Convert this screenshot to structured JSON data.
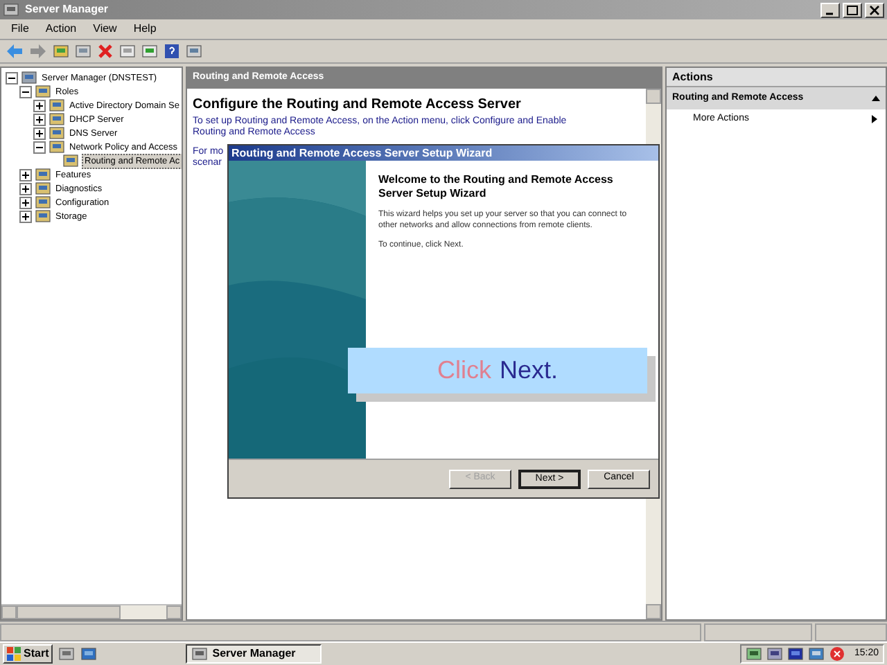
{
  "window": {
    "title": "Server Manager"
  },
  "menu": [
    "File",
    "Action",
    "View",
    "Help"
  ],
  "tree": [
    {
      "label": "Server Manager (DNSTEST)",
      "expanded": true,
      "selected": false,
      "children": [
        {
          "label": "Roles",
          "expanded": true,
          "selected": false,
          "children": [
            {
              "label": "Active Directory Domain Se",
              "expanded": false,
              "selected": false
            },
            {
              "label": "DHCP Server",
              "expanded": false,
              "selected": false
            },
            {
              "label": "DNS Server",
              "expanded": false,
              "selected": false
            },
            {
              "label": "Network Policy and Access",
              "expanded": true,
              "selected": false,
              "children": [
                {
                  "label": "Routing and Remote Ac",
                  "selected": true
                }
              ]
            }
          ]
        },
        {
          "label": "Features",
          "expanded": false,
          "selected": false
        },
        {
          "label": "Diagnostics",
          "expanded": false,
          "selected": false
        },
        {
          "label": "Configuration",
          "expanded": false,
          "selected": false
        },
        {
          "label": "Storage",
          "expanded": false,
          "selected": false
        }
      ]
    }
  ],
  "content": {
    "header": "Routing and Remote Access",
    "heading": "Configure the Routing and Remote Access Server",
    "line_1": "To set up Routing and Remote Access, on the Action menu, click Configure and Enable",
    "line_2": "Routing and Remote Access",
    "line_3": "For mo",
    "line_4": "scenar"
  },
  "actions": {
    "header": "Actions",
    "section": "Routing and Remote Access",
    "items": [
      "More Actions"
    ]
  },
  "wizard": {
    "title": "Routing and Remote Access Server Setup Wizard",
    "heading": "Welcome to the Routing and Remote Access Server Setup Wizard",
    "body": "This wizard helps you set up your server so that you can connect to other networks and allow connections from remote clients.",
    "prompt": "To continue, click Next.",
    "buttons": [
      {
        "label": "< Back",
        "disabled": true,
        "default": false
      },
      {
        "label": "Next >",
        "disabled": false,
        "default": true
      },
      {
        "label": "Cancel",
        "disabled": false,
        "default": false
      }
    ]
  },
  "callout": {
    "word_1": "Click",
    "word_2": "Next."
  },
  "taskbar": {
    "start": "Start",
    "task": "Server Manager",
    "time": "15:20"
  }
}
